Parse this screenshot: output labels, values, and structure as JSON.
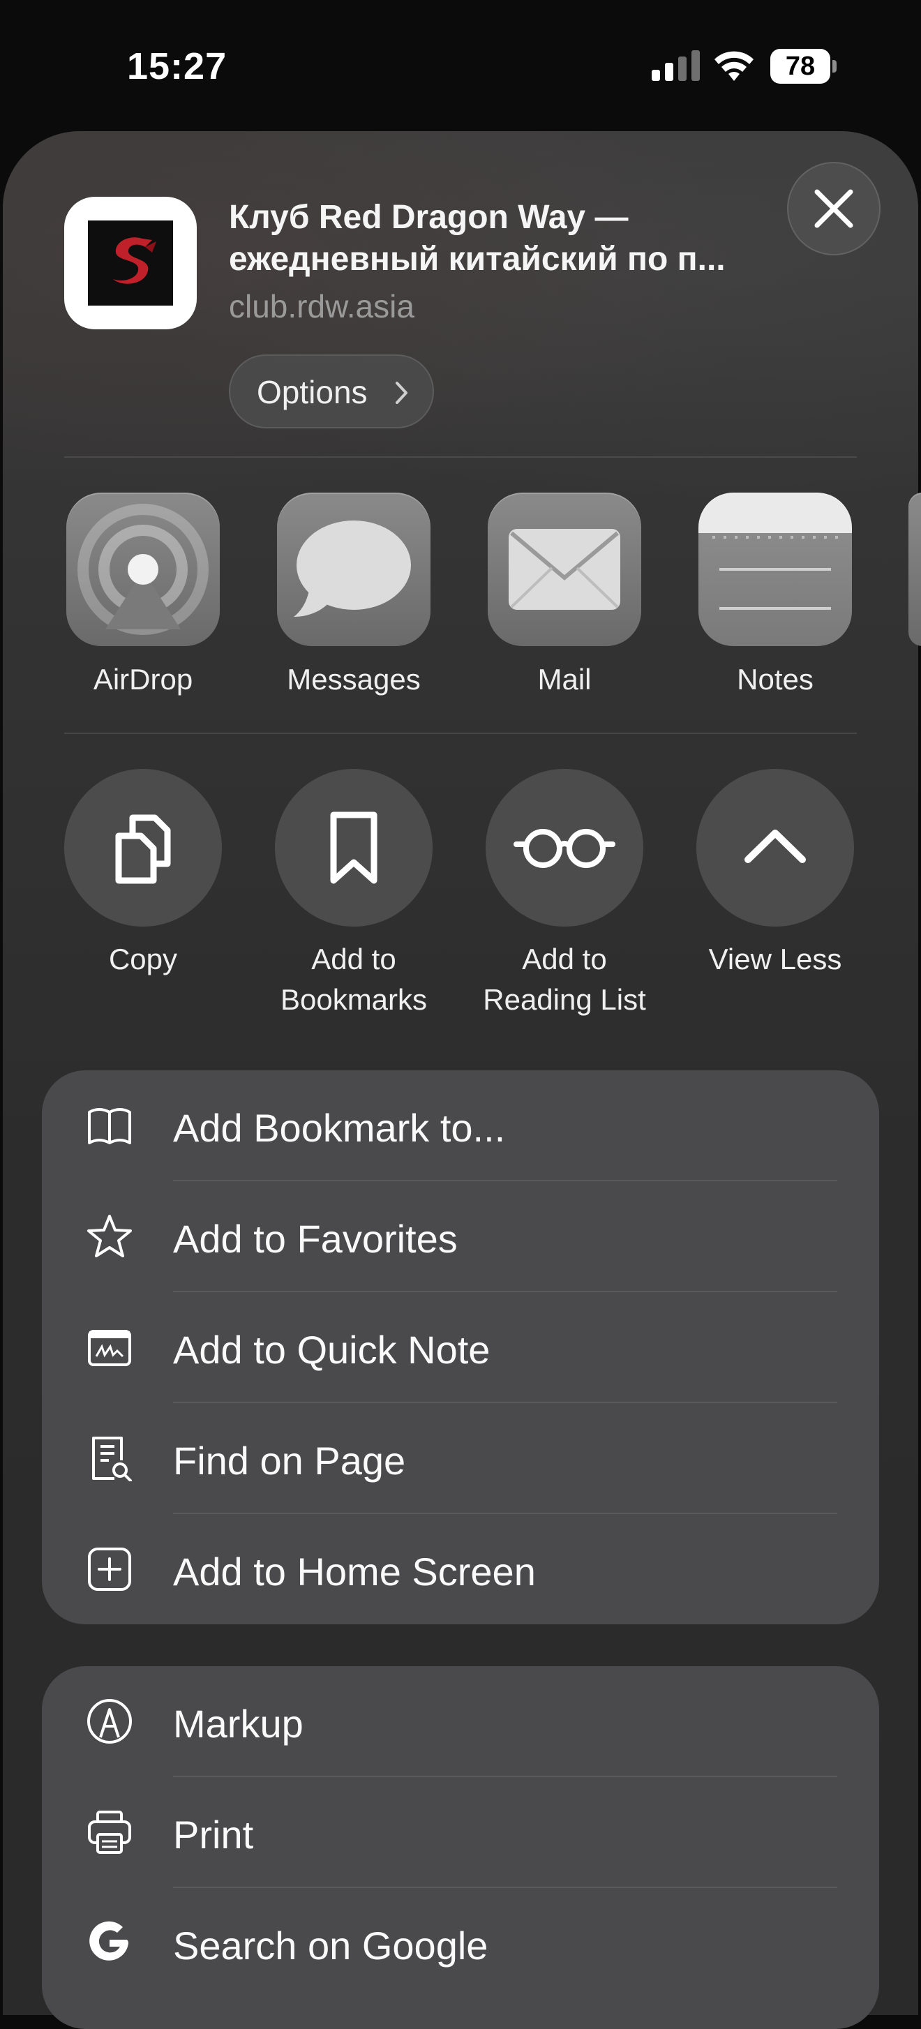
{
  "status": {
    "time": "15:27",
    "battery": "78"
  },
  "share": {
    "title_line1": "Клуб Red Dragon Way —",
    "title_line2": "ежедневный китайский по п...",
    "domain": "club.rdw.asia",
    "options_label": "Options"
  },
  "apps": [
    {
      "label": "AirDrop",
      "icon": "airdrop-icon"
    },
    {
      "label": "Messages",
      "icon": "messages-icon"
    },
    {
      "label": "Mail",
      "icon": "mail-icon"
    },
    {
      "label": "Notes",
      "icon": "notes-icon"
    }
  ],
  "actions": [
    {
      "line1": "Copy",
      "line2": "",
      "icon": "copy-icon"
    },
    {
      "line1": "Add to",
      "line2": "Bookmarks",
      "icon": "bookmark-icon"
    },
    {
      "line1": "Add to",
      "line2": "Reading List",
      "icon": "glasses-icon"
    },
    {
      "line1": "View Less",
      "line2": "",
      "icon": "chevron-up-icon"
    }
  ],
  "list1": [
    {
      "label": "Add Bookmark to...",
      "icon": "book-icon"
    },
    {
      "label": "Add to Favorites",
      "icon": "star-icon"
    },
    {
      "label": "Add to Quick Note",
      "icon": "quick-note-icon"
    },
    {
      "label": "Find on Page",
      "icon": "find-on-page-icon"
    },
    {
      "label": "Add to Home Screen",
      "icon": "add-square-icon"
    }
  ],
  "list2": [
    {
      "label": "Markup",
      "icon": "markup-icon"
    },
    {
      "label": "Print",
      "icon": "printer-icon"
    },
    {
      "label": "Search on Google",
      "icon": "google-icon"
    }
  ]
}
